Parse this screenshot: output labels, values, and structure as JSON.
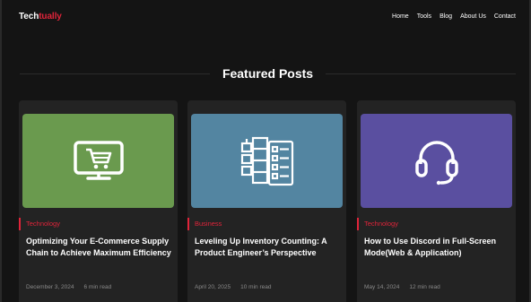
{
  "header": {
    "logo_part1": "Tech",
    "logo_part2": "tually",
    "nav": [
      "Home",
      "Tools",
      "Blog",
      "About Us",
      "Contact"
    ]
  },
  "section": {
    "title": "Featured Posts"
  },
  "colors": {
    "accent": "#e0243a",
    "background": "#141414",
    "card": "#232323",
    "thumb_green": "#6a9a4e",
    "thumb_blue": "#5385a1",
    "thumb_purple": "#5a4fa0"
  },
  "posts": [
    {
      "category": "Technology",
      "title": "Optimizing Your E-Commerce Supply Chain to Achieve Maximum Efficiency",
      "date": "December 3, 2024",
      "read_time": "6 min read",
      "icon": "shopping-cart-monitor-icon"
    },
    {
      "category": "Business",
      "title": "Leveling Up Inventory Counting: A Product Engineer’s Perspective",
      "date": "April 20, 2025",
      "read_time": "10 min read",
      "icon": "checklist-shelves-icon"
    },
    {
      "category": "Technology",
      "title": "How to Use Discord in Full-Screen Mode(Web & Application)",
      "date": "May 14, 2024",
      "read_time": "12 min read",
      "icon": "headset-icon"
    }
  ]
}
